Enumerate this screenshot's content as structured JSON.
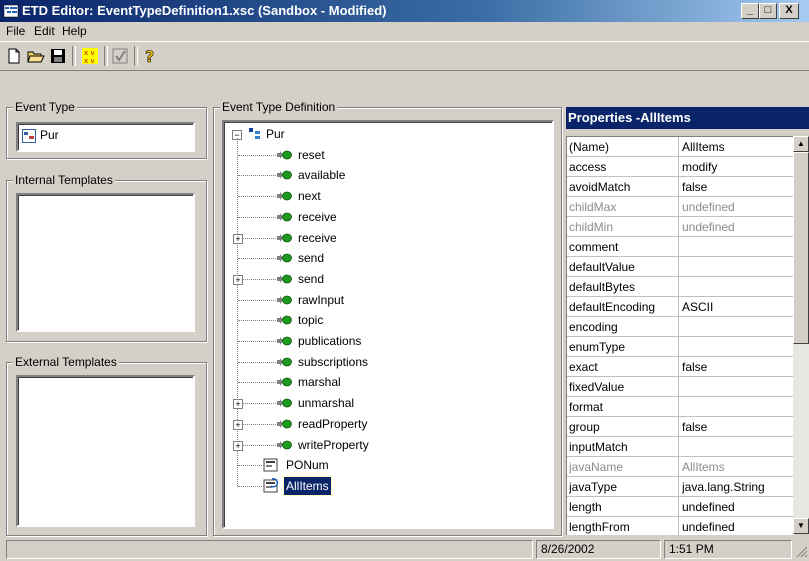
{
  "window": {
    "title": "ETD Editor: EventTypeDefinition1.xsc (Sandbox - Modified)",
    "min": "_",
    "max": "□",
    "close": "X"
  },
  "menu": [
    {
      "label": "File"
    },
    {
      "label": "Edit"
    },
    {
      "label": "Help"
    }
  ],
  "toolbar": {
    "icons": [
      "new-file-icon",
      "open-folder-icon",
      "save-icon",
      "check-icon",
      "compile-icon",
      "help-icon"
    ]
  },
  "event_type": {
    "label": "Event Type",
    "item": "Pur"
  },
  "internal_templates": {
    "label": "Internal Templates"
  },
  "external_templates": {
    "label": "External Templates"
  },
  "etd": {
    "label": "Event Type Definition",
    "root": "Pur",
    "nodes": [
      {
        "label": "reset",
        "expandable": false
      },
      {
        "label": "available",
        "expandable": false
      },
      {
        "label": "next",
        "expandable": false
      },
      {
        "label": "receive",
        "expandable": false
      },
      {
        "label": "receive",
        "expandable": true
      },
      {
        "label": "send",
        "expandable": false
      },
      {
        "label": "send",
        "expandable": true
      },
      {
        "label": "rawInput",
        "expandable": false
      },
      {
        "label": "topic",
        "expandable": false
      },
      {
        "label": "publications",
        "expandable": false
      },
      {
        "label": "subscriptions",
        "expandable": false
      },
      {
        "label": "marshal",
        "expandable": false
      },
      {
        "label": "unmarshal",
        "expandable": true
      },
      {
        "label": "readProperty",
        "expandable": true
      },
      {
        "label": "writeProperty",
        "expandable": true
      }
    ],
    "fields": [
      {
        "label": "PONum",
        "selected": false
      },
      {
        "label": "AllItems",
        "selected": true
      }
    ]
  },
  "properties": {
    "title": "Properties -AllItems",
    "rows": [
      {
        "name": "(Name)",
        "value": "AllItems",
        "dim": false
      },
      {
        "name": "access",
        "value": "modify",
        "dim": false
      },
      {
        "name": "avoidMatch",
        "value": "false",
        "dim": false
      },
      {
        "name": "childMax",
        "value": "undefined",
        "dim": true
      },
      {
        "name": "childMin",
        "value": "undefined",
        "dim": true
      },
      {
        "name": "comment",
        "value": "",
        "dim": false
      },
      {
        "name": "defaultValue",
        "value": "",
        "dim": false
      },
      {
        "name": "defaultBytes",
        "value": "",
        "dim": false
      },
      {
        "name": "defaultEncoding",
        "value": "ASCII",
        "dim": false
      },
      {
        "name": "encoding",
        "value": "",
        "dim": false
      },
      {
        "name": "enumType",
        "value": "",
        "dim": false
      },
      {
        "name": "exact",
        "value": "false",
        "dim": false
      },
      {
        "name": "fixedValue",
        "value": "",
        "dim": false
      },
      {
        "name": "format",
        "value": "",
        "dim": false
      },
      {
        "name": "group",
        "value": "false",
        "dim": false
      },
      {
        "name": "inputMatch",
        "value": "",
        "dim": false
      },
      {
        "name": "javaName",
        "value": "AllItems",
        "dim": true
      },
      {
        "name": "javaType",
        "value": "java.lang.String",
        "dim": false
      },
      {
        "name": "length",
        "value": "undefined",
        "dim": false
      },
      {
        "name": "lengthFrom",
        "value": "undefined",
        "dim": false
      }
    ]
  },
  "status": {
    "main": "",
    "date": "8/26/2002",
    "time": "1:51 PM"
  },
  "colors": {
    "titlebar": "#0a246a",
    "face": "#d4d0c8",
    "selection": "#0a246a",
    "method_icon": "#1e9a1e"
  }
}
